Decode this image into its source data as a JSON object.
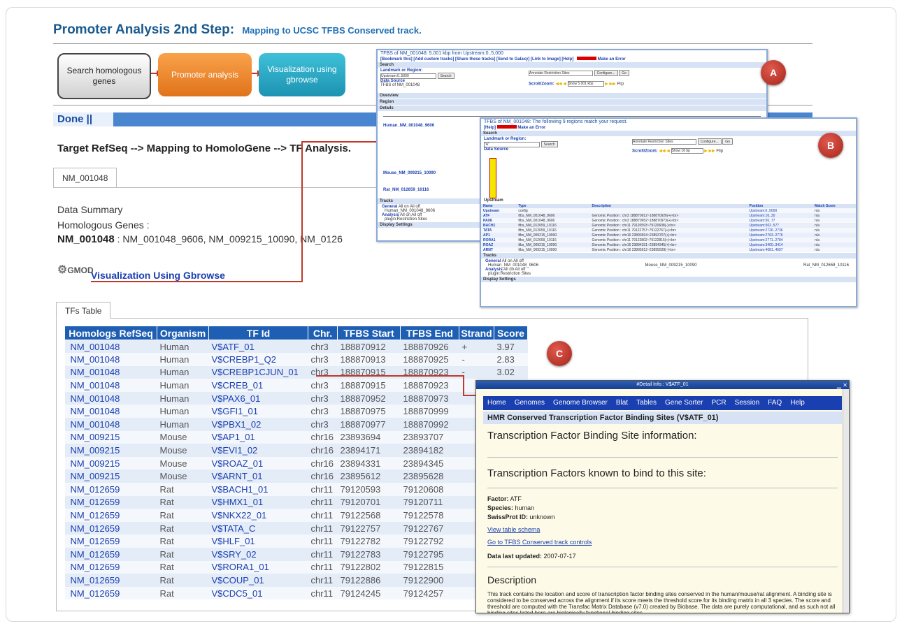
{
  "page": {
    "title": "Promoter Analysis 2nd Step:",
    "subtitle": "Mapping to UCSC TFBS Conserved track."
  },
  "flow": {
    "step1": "Search homologous genes",
    "step2": "Promoter analysis",
    "step3": "Visualization using gbrowse"
  },
  "done_label": "Done ||",
  "target_text": "Target RefSeq --> Mapping to HomoloGene --> TF Analysis.",
  "tab1": "NM_001048",
  "summary": {
    "data_summary": "Data Summary",
    "homologous_label": "Homologous Genes :",
    "gene_bold": "NM_001048",
    "gene_rest": " : NM_001048_9606, NM_009215_10090, NM_0126"
  },
  "viz": {
    "logo": "GMOD",
    "link": "Visualization Using Gbrowse"
  },
  "tab2": "TFs Table",
  "badges": {
    "a": "A",
    "b": "B",
    "c": "C"
  },
  "shot_a": {
    "title": "TFBS of NM_001048: 5.001 kbp from Upstream:0..5,000",
    "links": "[Bookmark this]  [Add custom tracks]  [Share these tracks]  [Send to Galaxy]  [Link to Image]  [Help]",
    "error": "Make an Error",
    "search": "Search",
    "landmark": "Landmark or Region:",
    "input": "Upstream:0..5000",
    "search_btn": "Search",
    "annotate": "Annotate Restriction Sites",
    "configure": "Configure...",
    "go": "Go",
    "datasource": "Data Source",
    "datasource_val": "TFBS of NM_001048",
    "scroll": "Scroll/Zoom:",
    "show": "Show 5.001 kbp",
    "flip": "Flip",
    "overview": "Overview",
    "region": "Region",
    "details": "Details",
    "human": "Human_NM_001048_9606",
    "mouse": "Mouse_NM_009215_10090",
    "rat": "Rat_NM_012659_10116",
    "tracks": "Tracks",
    "general": "General",
    "all_on": "All on",
    "all_off": "All off",
    "analysis": "Analysis",
    "restriction": "plugin:Restriction Sites",
    "display": "Display Settings"
  },
  "shot_b": {
    "title": "TFBS of NM_001048: The following 9 regions match your request.",
    "help": "[Help]",
    "error": "Make an Error",
    "search": "Search",
    "landmark": "Landmark or Region:",
    "input": "\"A\"",
    "search_btn": "Search",
    "annotate": "Annotate Restriction Sites",
    "configure": "Configure...",
    "go": "Go",
    "datasource": "Data Source",
    "scroll": "Scroll/Zoom:",
    "show": "Show 16 bp",
    "flip": "Flip",
    "upstream": "Upstream",
    "headers": [
      "Name",
      "Type",
      "Description",
      "Position",
      "Match Score"
    ],
    "rows": [
      [
        "Upstream",
        "config",
        "",
        "Upstream:0..5000",
        "n/a"
      ],
      [
        "ATF",
        "tfbs_NM_001048_9606",
        "Genomic Position : chr3 188870912~188870926(+)<br>",
        "Upstream:16..30",
        "n/a"
      ],
      [
        "PAX6",
        "tfbs_NM_001048_9606",
        "Genomic Position : chr3 188870952~188870973(+)<br>",
        "Upstream:56..77",
        "n/a"
      ],
      [
        "BACH1",
        "tfbs_NM_012659_10116",
        "Genomic Position : chr11 79120593~79120608(-)<br>",
        "Upstream:562..577",
        "n/a"
      ],
      [
        "TATA",
        "tfbs_NM_012659_10116",
        "Genomic Position : chr11 79122757~79122767(+)<br>",
        "Upstream:2726..2736",
        "n/a"
      ],
      [
        "AP1",
        "tfbs_NM_009215_10090",
        "Genomic Position : chr16 23893694~23893707(+)<br>",
        "Upstream:2763..2776",
        "n/a"
      ],
      [
        "RORA1",
        "tfbs_NM_012659_10116",
        "Genomic Position : chr11 79122802~79122815(+)<br>",
        "Upstream:2771..2784",
        "n/a"
      ],
      [
        "ROAZ",
        "tfbs_NM_009215_10090",
        "Genomic Position : chr16 23894331~23894345(+)<br>",
        "Upstream:3400..3414",
        "n/a"
      ],
      [
        "ARNT",
        "tfbs_NM_009215_10090",
        "Genomic Position : chr16 23895612~23895628(-)<br>",
        "Upstream:4681..4697",
        "n/a"
      ]
    ],
    "tracks": "Tracks",
    "general": "General",
    "all_on": "All on",
    "all_off": "All off",
    "human": "Human_NM_001048_9606",
    "mouse": "Mouse_NM_009215_10090",
    "rat": "Rat_NM_012659_10116",
    "analysis": "Analysis",
    "restriction": "plugin:Restriction Sites",
    "display": "Display Settings"
  },
  "table": {
    "headers": [
      "Homologs RefSeq",
      "Organism",
      "TF Id",
      "Chr.",
      "TFBS Start",
      "TFBS End",
      "Strand",
      "Score"
    ],
    "rows": [
      [
        "NM_001048",
        "Human",
        "V$ATF_01",
        "chr3",
        "188870912",
        "188870926",
        "+",
        "3.97"
      ],
      [
        "NM_001048",
        "Human",
        "V$CREBP1_Q2",
        "chr3",
        "188870913",
        "188870925",
        "-",
        "2.83"
      ],
      [
        "NM_001048",
        "Human",
        "V$CREBP1CJUN_01",
        "chr3",
        "188870915",
        "188870923",
        "-",
        "3.02"
      ],
      [
        "NM_001048",
        "Human",
        "V$CREB_01",
        "chr3",
        "188870915",
        "188870923",
        "",
        ""
      ],
      [
        "NM_001048",
        "Human",
        "V$PAX6_01",
        "chr3",
        "188870952",
        "188870973",
        "",
        ""
      ],
      [
        "NM_001048",
        "Human",
        "V$GFI1_01",
        "chr3",
        "188870975",
        "188870999",
        "",
        ""
      ],
      [
        "NM_001048",
        "Human",
        "V$PBX1_02",
        "chr3",
        "188870977",
        "188870992",
        "",
        ""
      ],
      [
        "NM_009215",
        "Mouse",
        "V$AP1_01",
        "chr16",
        "23893694",
        "23893707",
        "",
        ""
      ],
      [
        "NM_009215",
        "Mouse",
        "V$EVI1_02",
        "chr16",
        "23894171",
        "23894182",
        "",
        ""
      ],
      [
        "NM_009215",
        "Mouse",
        "V$ROAZ_01",
        "chr16",
        "23894331",
        "23894345",
        "",
        ""
      ],
      [
        "NM_009215",
        "Mouse",
        "V$ARNT_01",
        "chr16",
        "23895612",
        "23895628",
        "",
        ""
      ],
      [
        "NM_012659",
        "Rat",
        "V$BACH1_01",
        "chr11",
        "79120593",
        "79120608",
        "",
        ""
      ],
      [
        "NM_012659",
        "Rat",
        "V$HMX1_01",
        "chr11",
        "79120701",
        "79120711",
        "",
        ""
      ],
      [
        "NM_012659",
        "Rat",
        "V$NKX22_01",
        "chr11",
        "79122568",
        "79122578",
        "",
        ""
      ],
      [
        "NM_012659",
        "Rat",
        "V$TATA_C",
        "chr11",
        "79122757",
        "79122767",
        "",
        ""
      ],
      [
        "NM_012659",
        "Rat",
        "V$HLF_01",
        "chr11",
        "79122782",
        "79122792",
        "",
        ""
      ],
      [
        "NM_012659",
        "Rat",
        "V$SRY_02",
        "chr11",
        "79122783",
        "79122795",
        "",
        ""
      ],
      [
        "NM_012659",
        "Rat",
        "V$RORA1_01",
        "chr11",
        "79122802",
        "79122815",
        "",
        ""
      ],
      [
        "NM_012659",
        "Rat",
        "V$COUP_01",
        "chr11",
        "79122886",
        "79122900",
        "",
        ""
      ],
      [
        "NM_012659",
        "Rat",
        "V$CDC5_01",
        "chr11",
        "79124245",
        "79124257",
        "",
        ""
      ]
    ]
  },
  "detail": {
    "window_title": "#Detail Info.: V$ATF_01",
    "nav": [
      "Home",
      "Genomes",
      "Genome Browser",
      "Blat",
      "Tables",
      "Gene Sorter",
      "PCR",
      "Session",
      "FAQ",
      "Help"
    ],
    "subtitle": "HMR Conserved Transcription Factor Binding Sites (V$ATF_01)",
    "h1": "Transcription Factor Binding Site information:",
    "h2": "Transcription Factors known to bind to this site:",
    "factor_label": "Factor:",
    "factor": "ATF",
    "species_label": "Species:",
    "species": "human",
    "swiss_label": "SwissProt ID:",
    "swiss": "unknown",
    "link1": "View table schema",
    "link2": "Go to TFBS Conserved track controls",
    "updated_label": "Data last updated:",
    "updated": "2007-07-17",
    "desc_h": "Description",
    "desc": "This track contains the location and score of transcription factor binding sites conserved in the human/mouse/rat alignment. A binding site is considered to be conserved across the alignment if its score meets the threshold score for its binding matrix in all 3 species. The score and threshold are computed with the Transfac Matrix Database (v7.0) created by Biobase. The data are purely computational, and as such not all binding sites listed here are biologically functional binding sites."
  }
}
